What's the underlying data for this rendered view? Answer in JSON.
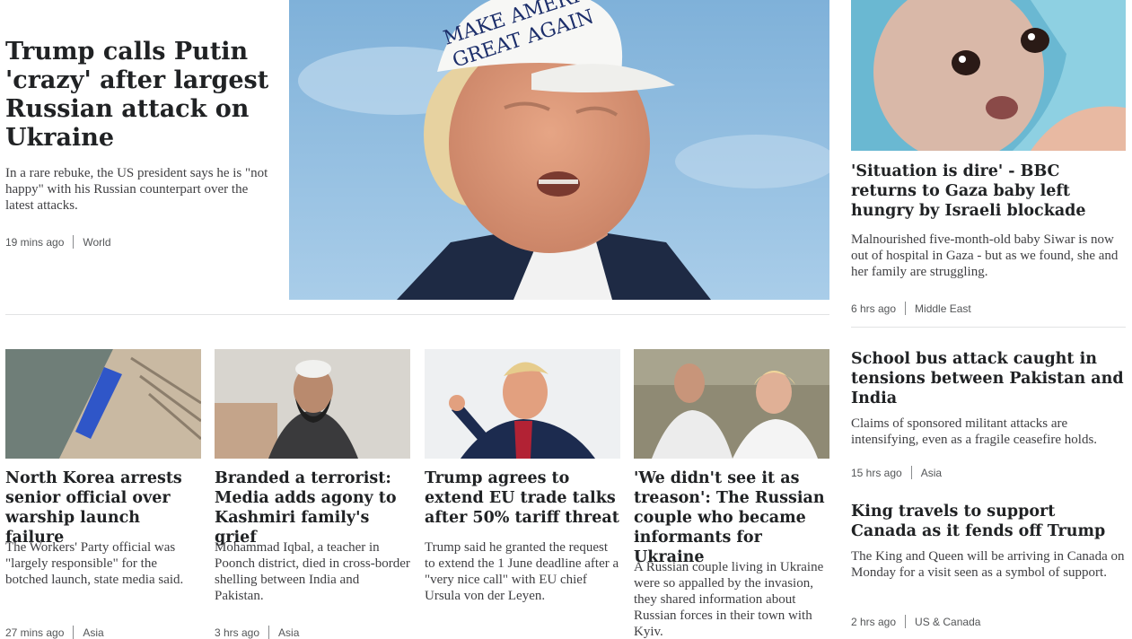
{
  "lead": {
    "title": "Trump calls Putin 'crazy' after largest Russian attack on Ukraine",
    "summary": "In a rare rebuke, the US president says he is \"not happy\" with his Russian counterpart over the latest attacks.",
    "time": "19 mins ago",
    "section": "World",
    "image_text_line1": "MAKE AMERICA",
    "image_text_line2": "GREAT AGAIN"
  },
  "right_column": [
    {
      "title": "'Situation is dire' - BBC returns to Gaza baby left hungry by Israeli blockade",
      "summary": "Malnourished five-month-old baby Siwar is now out of hospital in Gaza - but as we found, she and her family are struggling.",
      "time": "6 hrs ago",
      "section": "Middle East"
    },
    {
      "title": "School bus attack caught in tensions between Pakistan and India",
      "summary": "Claims of sponsored militant attacks are intensifying, even as a fragile ceasefire holds.",
      "time": "15 hrs ago",
      "section": "Asia"
    },
    {
      "title": "King travels to support Canada as it fends off Trump",
      "summary": "The King and Queen will be arriving in Canada on Monday for a visit seen as a symbol of support.",
      "time": "2 hrs ago",
      "section": "US & Canada"
    }
  ],
  "grid": [
    {
      "title": "North Korea arrests senior official over warship launch failure",
      "summary": "The Workers' Party official was \"largely responsible\" for the botched launch, state media said.",
      "time": "27 mins ago",
      "section": "Asia"
    },
    {
      "title": "Branded a terrorist: Media adds agony to Kashmiri family's grief",
      "summary": "Mohammad Iqbal, a teacher in Poonch district, died in cross-border shelling between India and Pakistan.",
      "time": "3 hrs ago",
      "section": "Asia"
    },
    {
      "title": "Trump agrees to extend EU trade talks after 50% tariff threat",
      "summary": "Trump said he granted the request to extend the 1 June deadline after a \"very nice call\" with EU chief Ursula von der Leyen."
    },
    {
      "title": "'We didn't see it as treason': The Russian couple who became informants for Ukraine",
      "summary": "A Russian couple living in Ukraine were so appalled by the invasion, they shared information about Russian forces in their town with Kyiv."
    }
  ]
}
